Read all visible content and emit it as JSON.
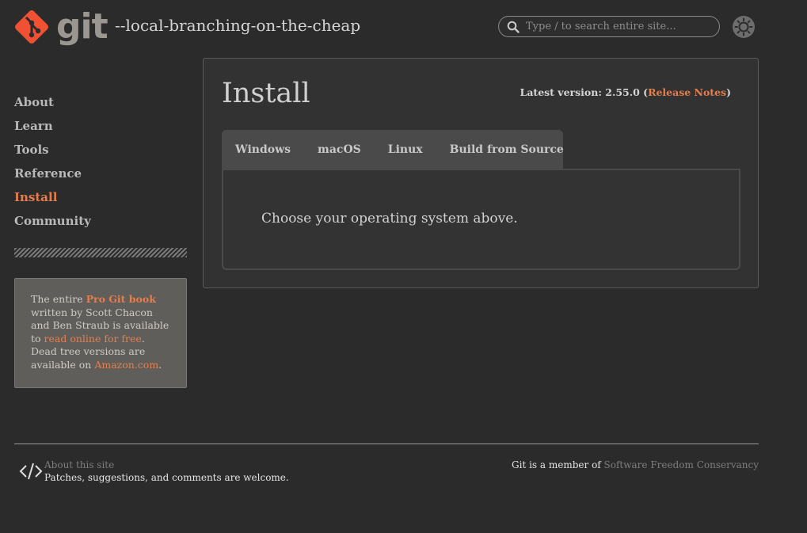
{
  "header": {
    "logo_text": "git",
    "tagline": "--local-branching-on-the-cheap",
    "search_placeholder": "Type / to search entire site...",
    "icons": {
      "logo": "git-diamond-logo",
      "search": "search-icon",
      "theme": "sun-icon"
    }
  },
  "sidebar": {
    "items": [
      {
        "label": "About"
      },
      {
        "label": "Learn"
      },
      {
        "label": "Tools"
      },
      {
        "label": "Reference"
      },
      {
        "label": "Install",
        "active": true
      },
      {
        "label": "Community"
      }
    ],
    "book": {
      "t1": "The entire ",
      "link1": "Pro Git book",
      "t2": " written by Scott Chacon and Ben Straub is available to ",
      "link2": "read online for free",
      "t3": ". Dead tree versions are available on ",
      "link3": "Amazon.com",
      "t4": "."
    }
  },
  "main": {
    "title": "Install",
    "version_prefix": "Latest version: 2.55.0 (",
    "version_link": "Release Notes",
    "version_suffix": ")",
    "tabs": [
      {
        "label": "Windows"
      },
      {
        "label": "macOS"
      },
      {
        "label": "Linux"
      },
      {
        "label": "Build from Source"
      }
    ],
    "content": "Choose your operating system above."
  },
  "footer": {
    "about": "About this site",
    "patches": "Patches, suggestions, and comments are welcome.",
    "member_prefix": "Git is a member of ",
    "member_link": "Software Freedom Conservancy"
  },
  "colors": {
    "background": "#2b2b2b",
    "accent": "#e67e4c",
    "logo": "#f05133"
  }
}
